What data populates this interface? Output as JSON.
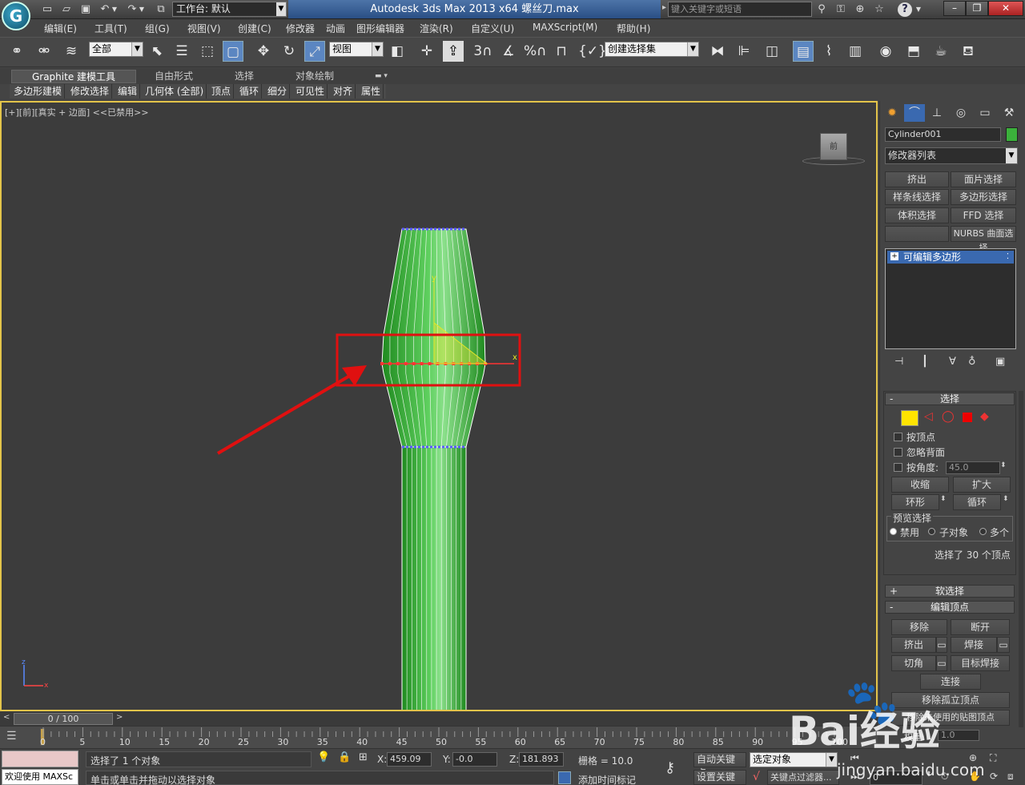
{
  "titlebar": {
    "logo": "G",
    "workspace_label": "工作台: 默认",
    "title": "Autodesk 3ds Max  2013 x64       螺丝刀.max",
    "search_placeholder": "键入关键字或短语",
    "help": "?",
    "minimize": "–",
    "restore": "❐",
    "close": "✕"
  },
  "menu": [
    "编辑(E)",
    "工具(T)",
    "组(G)",
    "视图(V)",
    "创建(C)",
    "修改器",
    "动画",
    "图形编辑器",
    "渲染(R)",
    "自定义(U)",
    "MAXScript(M)",
    "帮助(H)"
  ],
  "toolbar": {
    "filter_value": "全部",
    "refcoord_value": "视图",
    "named_sel_value": "创建选择集",
    "snap_3": "3",
    "snap_pct": "%"
  },
  "ribbon": {
    "tabs": [
      "Graphite 建模工具",
      "自由形式",
      "选择",
      "对象绘制"
    ],
    "panels": [
      "多边形建模",
      "修改选择",
      "编辑",
      "几何体 (全部)",
      "顶点",
      "循环",
      "细分",
      "可见性",
      "对齐",
      "属性"
    ]
  },
  "viewport": {
    "label": "[+][前][真实 + 边面] <<已禁用>>",
    "viewcube_label": "前",
    "axis_y": "y",
    "axis_x": "x",
    "tripod_z": "z",
    "tripod_x": "x",
    "colors": {
      "mesh_fill": "#3fbf3f",
      "mesh_edge": "#ffffff",
      "selected_vertex": "#ff3333",
      "top_vertex": "#5a5aff",
      "highlight_box": "#e01010",
      "gizmo": "#e6e626"
    }
  },
  "cmdpanel": {
    "object_name": "Cylinder001",
    "object_color": "#3bb13b",
    "modifier_list": "修改器列表",
    "buttons": [
      [
        "挤出",
        "面片选择"
      ],
      [
        "样条线选择",
        "多边形选择"
      ],
      [
        "体积选择",
        "FFD 选择"
      ],
      [
        "",
        "NURBS 曲面选择"
      ]
    ],
    "stack_item": "可编辑多边形",
    "selection": {
      "title": "选择",
      "by_vertex": "按顶点",
      "ignore_backface": "忽略背面",
      "by_angle": "按角度:",
      "angle_value": "45.0",
      "shrink": "收缩",
      "grow": "扩大",
      "ring": "环形",
      "loop": "循环",
      "preview_title": "预览选择",
      "preview_off": "禁用",
      "preview_sub": "子对象",
      "preview_multi": "多个",
      "status": "选择了 30 个顶点"
    },
    "soft_selection": "软选择",
    "edit_vertices": {
      "title": "编辑顶点",
      "remove": "移除",
      "break": "断开",
      "extrude": "挤出",
      "weld": "焊接",
      "chamfer": "切角",
      "target_weld": "目标焊接",
      "connect": "连接",
      "remove_isolated": "移除孤立顶点",
      "remove_unused": "移除未使用的贴图顶点",
      "weight_label": "权重:",
      "weight_value": "1.0"
    }
  },
  "timeline": {
    "thumb": "0 / 100",
    "ticks": [
      "0",
      "5",
      "10",
      "15",
      "20",
      "25",
      "30",
      "35",
      "40",
      "45",
      "50",
      "55",
      "60",
      "65",
      "70",
      "75",
      "80",
      "85",
      "90",
      "95",
      "100"
    ]
  },
  "status": {
    "maxscript": "欢迎使用 MAXSc",
    "line1": "选择了 1 个对象",
    "line2": "单击或单击并拖动以选择对象",
    "x_label": "X:",
    "x_value": "459.09",
    "y_label": "Y:",
    "y_value": "-0.0",
    "z_label": "Z:",
    "z_value": "181.893",
    "grid": "栅格 = 10.0",
    "add_time_tag": "添加时间标记",
    "auto_key": "自动关键点",
    "set_key": "设置关键点",
    "key_target": "选定对象",
    "key_filters": "关键点过滤器...",
    "frame_value": "0"
  },
  "watermark": {
    "logo": "Bai经验",
    "url": "jingyan.baidu.com"
  }
}
